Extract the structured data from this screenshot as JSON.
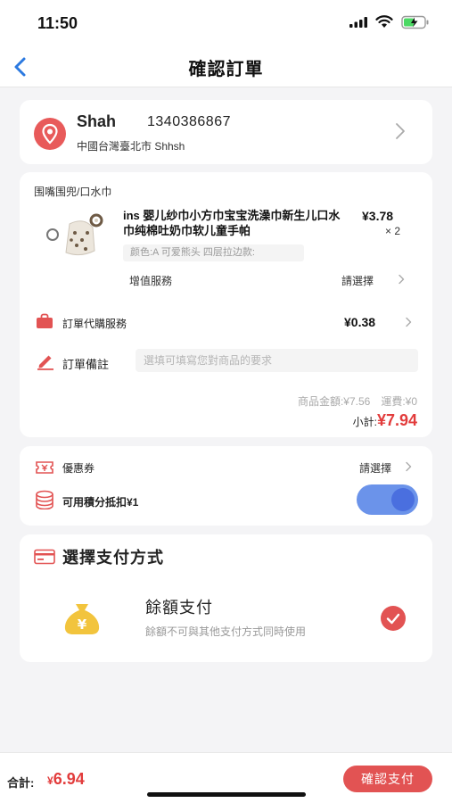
{
  "status_bar": {
    "time": "11:50"
  },
  "nav": {
    "title": "確認訂單"
  },
  "address": {
    "name": "Shah",
    "phone": "1340386867",
    "location": "中國台灣臺北市 Shhsh"
  },
  "order": {
    "shop": "围嘴围兜/口水巾",
    "product_name": "ins 婴儿纱巾小方巾宝宝洗澡巾新生儿口水巾纯棉吐奶巾软儿童手帕",
    "price": "¥3.78",
    "quantity": "× 2",
    "spec": "颜色:A 可爱熊头 四层拉边款:",
    "value_added_label": "增值服務",
    "value_added_value": "請選擇",
    "proxy_label": "訂單代購服務",
    "proxy_value": "¥0.38",
    "note_label": "訂單備註",
    "note_placeholder": "選填可填寫您對商品的要求",
    "goods_amount": "商品金額:¥7.56",
    "shipping": "運費:¥0",
    "subtotal_label": "小計:",
    "subtotal_amount": "¥7.94"
  },
  "discounts": {
    "coupon_label": "優惠券",
    "coupon_value": "請選擇",
    "points_label": "可用積分抵扣¥1",
    "points_enabled": true
  },
  "payment": {
    "title": "選擇支付方式",
    "method": "餘額支付",
    "method_desc": "餘額不可與其他支付方式同時使用",
    "selected": true
  },
  "footer": {
    "total_label": "合計:",
    "total_currency": "¥",
    "total_amount": "6.94",
    "confirm_button": "確認支付"
  },
  "colors": {
    "accent_red": "#e25353",
    "toggle_blue": "#6b93ea",
    "background": "#f4f4f6"
  }
}
